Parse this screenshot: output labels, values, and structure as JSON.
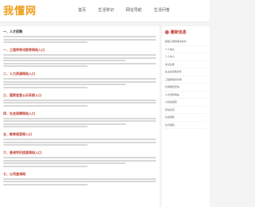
{
  "header": {
    "logo": "我懂网",
    "nav": [
      "首页",
      "生活常识",
      "网址导航",
      "生活问答"
    ]
  },
  "sections": [
    {
      "title": "一、人才招聘",
      "style": "dark",
      "lines": 3
    },
    {
      "title": "一、工程师考试报考网站入口",
      "style": "red",
      "lines": 5
    },
    {
      "title": "二、人力资源网站入口",
      "style": "red",
      "lines": 4
    },
    {
      "title": "三、国家信息公示系统入口",
      "style": "red",
      "lines": 3
    },
    {
      "title": "四、社会保障网站入口",
      "style": "red",
      "lines": 4
    },
    {
      "title": "五、教育局官网入口",
      "style": "red",
      "lines": 3
    },
    {
      "title": "六、查询学历信息网站入口",
      "style": "red",
      "lines": 4
    },
    {
      "title": "七、公司查询网",
      "style": "red",
      "lines": 3
    }
  ],
  "sidebar": {
    "title": "最新信息",
    "items": [
      "助理工程师报考条件",
      "个人信息",
      "个人中心",
      "考试注册",
      "失业金领取条件",
      "工程师职称评审",
      "社保缴费查询",
      "人才招聘网站",
      "公积金提取",
      "劳动合同",
      "社会保险",
      "生育保险"
    ]
  }
}
